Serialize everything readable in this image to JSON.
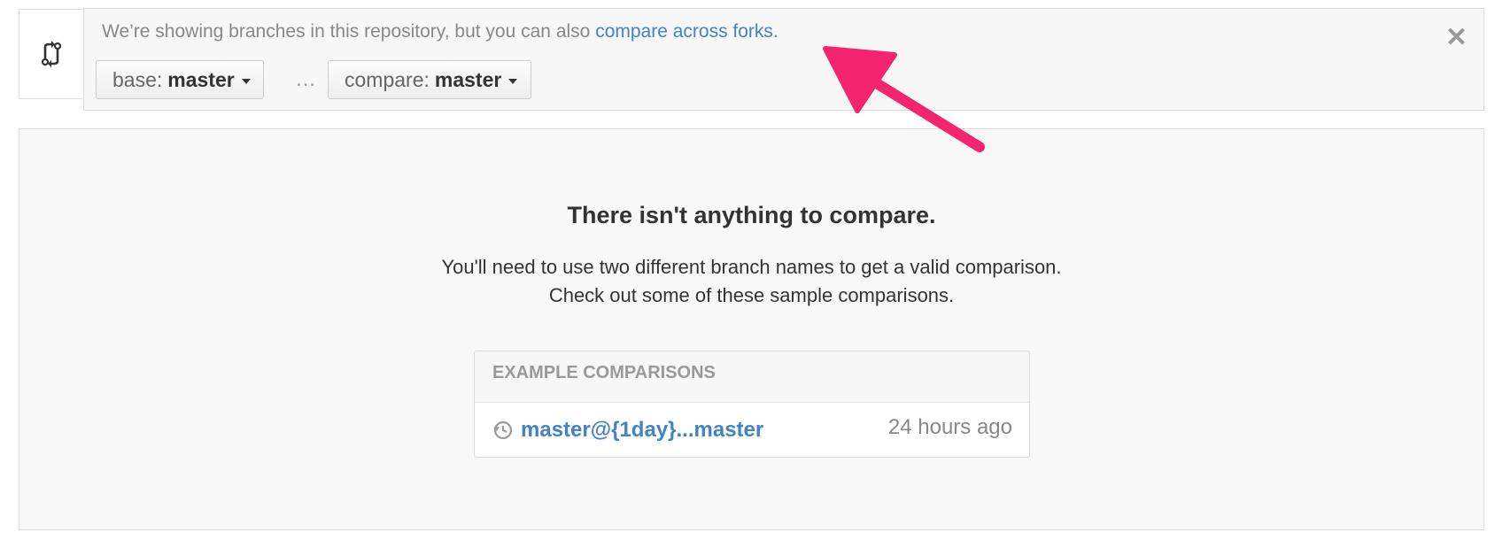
{
  "info": {
    "text": "We’re showing branches in this repository, but you can also",
    "link": "compare across forks."
  },
  "base": {
    "label": "base:",
    "value": "master"
  },
  "ellipsis": "…",
  "compare": {
    "label": "compare:",
    "value": "master"
  },
  "close": "✕",
  "blankslate": {
    "title": "There isn't anything to compare.",
    "line1": "You'll need to use two different branch names to get a valid comparison.",
    "line2": "Check out some of these sample comparisons."
  },
  "examples": {
    "header": "EXAMPLE COMPARISONS",
    "items": [
      {
        "label": "master@{1day}...master",
        "time": "24 hours ago"
      }
    ]
  },
  "colors": {
    "link": "#4183c4",
    "arrow": "#f4246e"
  }
}
